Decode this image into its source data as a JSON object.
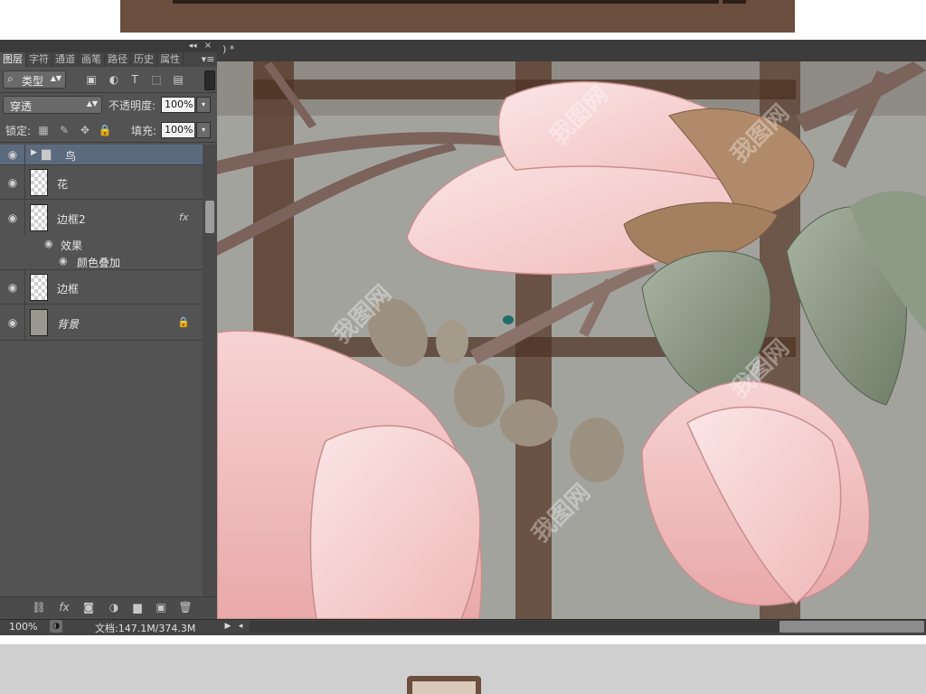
{
  "panel": {
    "collapse_glyph": "◂◂",
    "close_glyph": "×",
    "tabs": [
      {
        "label": "图层",
        "active": true
      },
      {
        "label": "字符"
      },
      {
        "label": "通道"
      },
      {
        "label": "画笔"
      },
      {
        "label": "路径"
      },
      {
        "label": "历史"
      },
      {
        "label": "属性"
      }
    ],
    "menu_glyph": "▾≡",
    "filter": {
      "label": "类型",
      "icons": [
        "image-filter-icon",
        "adjustment-filter-icon",
        "type-filter-icon",
        "shape-filter-icon",
        "smart-object-filter-icon"
      ]
    },
    "blend_mode": "穿透",
    "opacity_label": "不透明度:",
    "opacity_value": "100%",
    "lock_label": "锁定:",
    "fill_label": "填充:",
    "fill_value": "100%",
    "layers": [
      {
        "name": "鸟",
        "type": "group",
        "selected": true
      },
      {
        "name": "花",
        "type": "layer"
      },
      {
        "name": "边框2",
        "type": "layer",
        "fx": "fx"
      },
      {
        "name": "效果",
        "type": "effects-header"
      },
      {
        "name": "颜色叠加",
        "type": "effect"
      },
      {
        "name": "边框",
        "type": "layer"
      },
      {
        "name": "背景",
        "type": "background",
        "locked": true
      }
    ],
    "footer_icons": [
      "link-icon",
      "fx-icon",
      "mask-icon",
      "adjustment-icon",
      "folder-icon",
      "new-layer-icon",
      "trash-icon"
    ]
  },
  "document": {
    "tab_title": ") *"
  },
  "status": {
    "zoom": "100%",
    "doc_size": "文档:147.1M/374.3M"
  },
  "colors": {
    "panel_bg": "#535353",
    "selected_row": "#5c6a7d",
    "frame_brown": "#6b4e3e"
  }
}
